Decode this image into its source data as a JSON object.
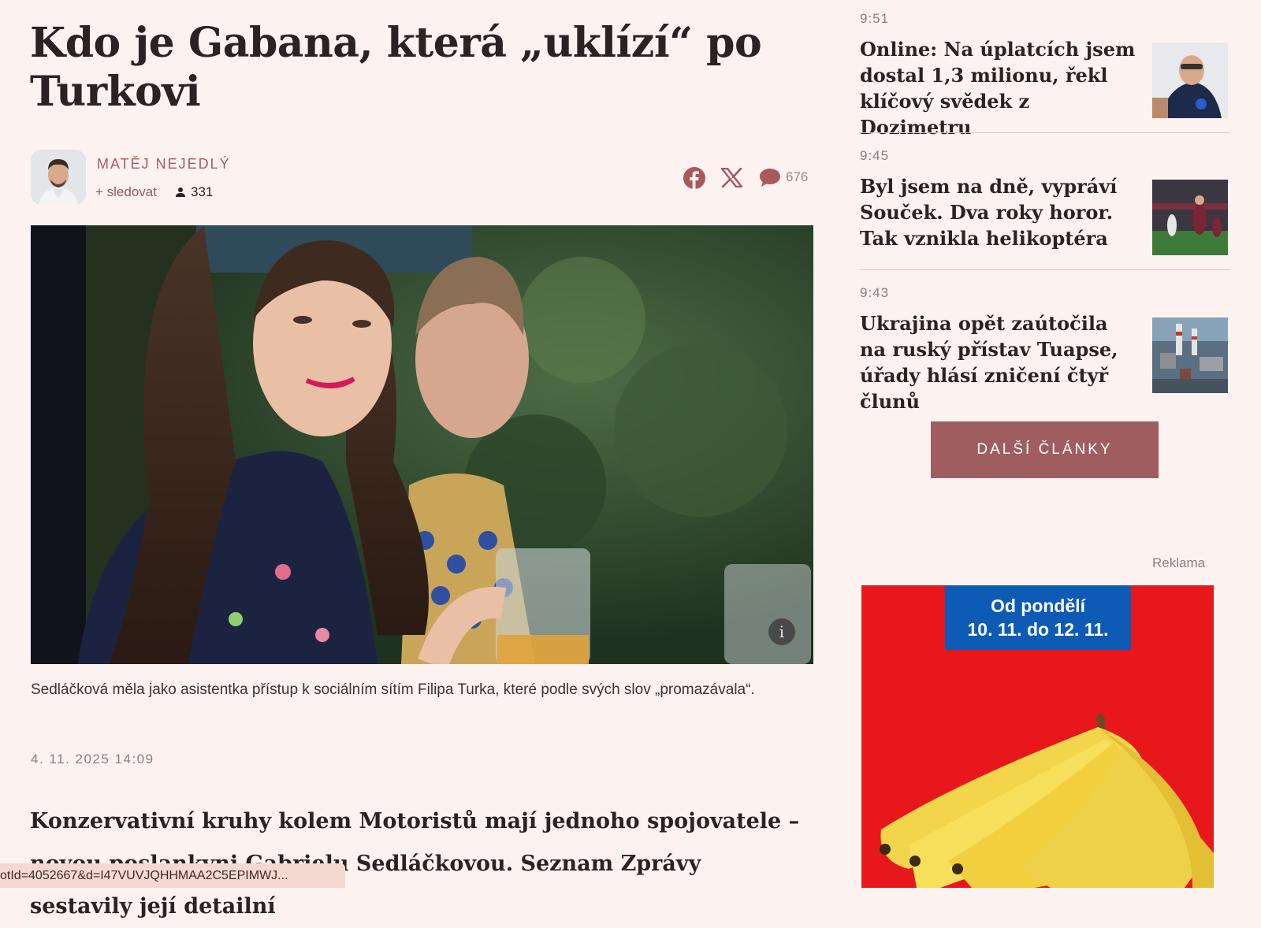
{
  "article": {
    "headline": "Kdo je Gabana, která „uklízí“ po Turkovi",
    "author": {
      "name": "MATĚJ NEJEDLÝ",
      "follow_label": "+ sledovat",
      "followers": "331"
    },
    "comments_count": "676",
    "photo_caption": "Sedláčková měla jako asistentka přístup k sociálním sítím Filipa Turka, které podle svých slov „promazávala“.",
    "photo_info": "i",
    "date": "4. 11. 2025 14:09",
    "lead": "Konzervativní kruhy kolem Motoristů mají jednoho spojovatele – novou poslankyni Gabrielu Sedláčkovou. Seznam Zprávy sestavily její detailní"
  },
  "sidebar": {
    "news": [
      {
        "time": "9:51",
        "title": "Online: Na úplatcích jsem dostal 1,3 milionu, řekl klíčový svědek z Dozimetru"
      },
      {
        "time": "9:45",
        "title": "Byl jsem na dně, vypráví Souček. Dva roky horor. Tak vznikla helikoptéra"
      },
      {
        "time": "9:43",
        "title": "Ukrajina opět zaútočila na ruský přístav Tuapse, úřady hlásí zničení čtyř člunů"
      }
    ],
    "more_button": "DALŠÍ ČLÁNKY",
    "ad_label": "Reklama",
    "ad": {
      "line1": "Od pondělí",
      "line2": "10. 11. do 12. 11."
    }
  },
  "status_bar": {
    "url": "otId=4052667&d=I47VUVJQHHMAA2C5EPIMWJ..."
  },
  "colors": {
    "background": "#fcf2f0",
    "accent": "#a05d60",
    "author": "#a9595c",
    "ad_red": "#e8171c",
    "ad_blue": "#0d5bb5"
  }
}
